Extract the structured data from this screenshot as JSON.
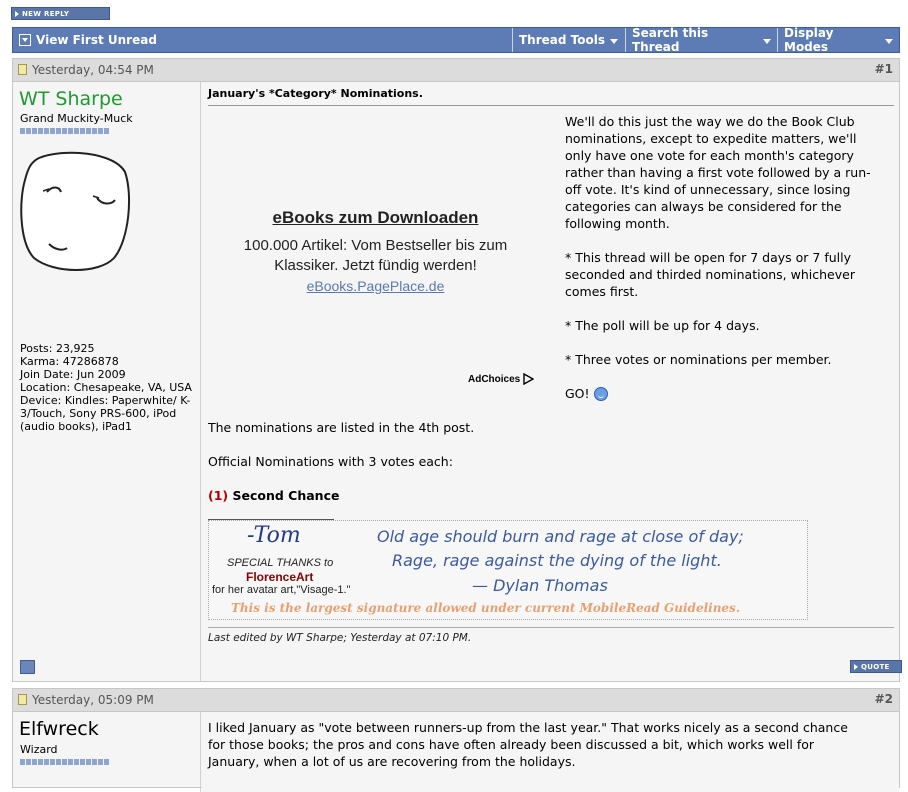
{
  "top": {
    "new_reply_label": "NEW REPLY"
  },
  "toolbar": {
    "view_first_unread": "View First Unread",
    "thread_tools": "Thread Tools",
    "search_thread": "Search this Thread",
    "display_modes": "Display Modes"
  },
  "post1": {
    "date": "Yesterday, 04:54 PM",
    "number": "#1",
    "username": "WT Sharpe",
    "user_title": "Grand Muckity-Muck",
    "stats": {
      "posts": "Posts: 23,925",
      "karma": "Karma: 47286878",
      "join": "Join Date: Jun 2009",
      "location": "Location: Chesapeake, VA, USA",
      "device": "Device: Kindles: Paperwhite/ K-3/Touch, Sony PRS-600, iPod (audio books), iPad1"
    },
    "title": "January's *Category* Nominations.",
    "ad": {
      "title": "eBooks zum Downloaden",
      "text": "100.000 Artikel: Vom Bestseller bis zum Klassiker. Jetzt fündig werden!",
      "link": "eBooks.PagePlace.de",
      "choices": "AdChoices"
    },
    "paragraphs": [
      "We'll do this just the way we do the Book Club nominations, except to expedite matters, we'll only have one vote for each month's category rather than having a first vote followed by a run-off vote. It's kind of unnecessary, since losing categories can always be considered for the following month.",
      "* This thread will be open for 7 days or 7 fully seconded and thirded nominations, whichever comes first.",
      "* The poll will be up for 4 days.",
      "* Three votes or nominations per member."
    ],
    "go": "GO!",
    "line1": "The nominations are listed in the 4th post.",
    "line2": "Official Nominations with 3 votes each:",
    "nom_number": "(1)",
    "nom_title": "Second Chance",
    "sig": {
      "name": "-Tom",
      "thanks_prefix": "SPECIAL THANKS",
      "thanks_to": " to",
      "artist": "FlorenceArt",
      "avatar_credit": "for her avatar art,\"Visage-1.\"",
      "poem1": "Old age should burn and rage at close of day;",
      "poem2": "Rage, rage against the dying of the light.",
      "poem3": "— Dylan Thomas",
      "note": "This is the largest signature allowed under current MobileRead Guidelines."
    },
    "edited": "Last edited by WT Sharpe; Yesterday at 07:10 PM.",
    "quote_label": "QUOTE"
  },
  "post2": {
    "date": "Yesterday, 05:09 PM",
    "number": "#2",
    "username": "Elfwreck",
    "user_title": "Wizard",
    "text": "I liked January as \"vote between runners-up from the last year.\" That works nicely as a second chance for those books; the pros and cons have often already been discussed a bit, which works well for January, when a lot of us are recovering from the holidays."
  },
  "colors": {
    "toolbar": "#5d7cb5",
    "username_green": "#1f9a2e",
    "artist_red": "#8b0000",
    "sig_note": "#e8a070",
    "poem_blue": "#3a5aa0"
  }
}
